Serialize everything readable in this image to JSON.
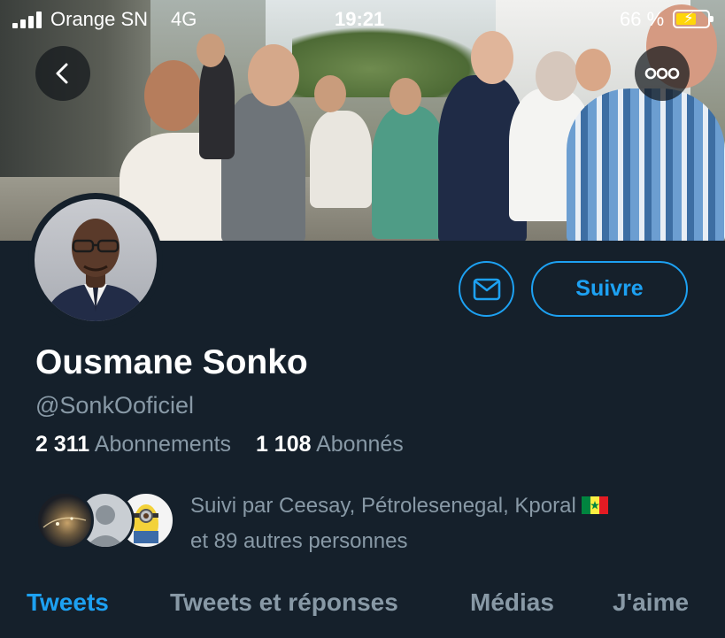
{
  "status_bar": {
    "carrier": "Orange SN",
    "network": "4G",
    "time": "19:21",
    "battery_percent": "66 %",
    "battery_level": 0.66,
    "battery_color": "#ffd60a"
  },
  "header": {
    "back_icon": "chevron-left-icon",
    "more_icon": "more-horizontal-icon"
  },
  "profile": {
    "name": "Ousmane Sonko",
    "handle": "@SonkOoficiel",
    "following_count": "2 311",
    "following_label": "Abonnements",
    "followers_count": "1 108",
    "followers_label": "Abonnés",
    "followed_by_line1": "Suivi par Ceesay, Pétrolesenegal, Kporal",
    "followed_by_line2": "et 89 autres personnes",
    "flag_icon": "senegal-flag-icon"
  },
  "actions": {
    "message_icon": "mail-icon",
    "follow_label": "Suivre"
  },
  "tabs": [
    {
      "label": "Tweets",
      "active": true
    },
    {
      "label": "Tweets et réponses",
      "active": false
    },
    {
      "label": "Médias",
      "active": false
    },
    {
      "label": "J'aime",
      "active": false
    }
  ],
  "colors": {
    "background": "#15202b",
    "accent": "#1da1f2",
    "secondary_text": "#8899a6"
  }
}
